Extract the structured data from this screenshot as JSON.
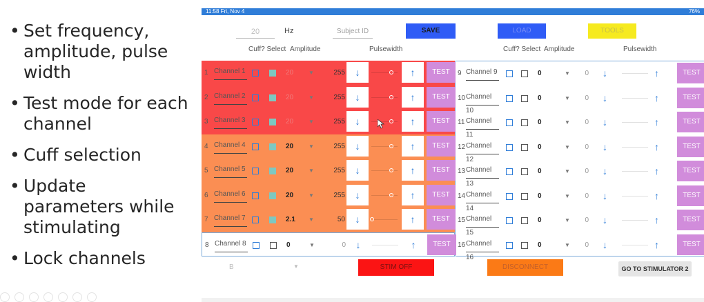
{
  "bullets": [
    "Set frequency, amplitude, pulse width",
    "Test mode for each channel",
    "Cuff selection",
    "Update parameters while stimulating",
    "Lock channels"
  ],
  "status_bar": {
    "left": "11:58  Fri, Nov 4",
    "right": "76%"
  },
  "top": {
    "frequency_value": "20",
    "frequency_unit": "Hz",
    "subject_placeholder": "Subject ID",
    "save_label": "SAVE",
    "load_label": "LOAD",
    "tools_label": "TOOLS"
  },
  "headers": {
    "cuff_select": "Cuff? Select",
    "amplitude": "Amplitude",
    "pulsewidth": "Pulsewidth"
  },
  "left_channels": [
    {
      "num": "1",
      "name": "Channel 1",
      "amp": "20",
      "pw": "255",
      "test": "TEST"
    },
    {
      "num": "2",
      "name": "Channel 2",
      "amp": "20",
      "pw": "255",
      "test": "TEST"
    },
    {
      "num": "3",
      "name": "Channel 3",
      "amp": "20",
      "pw": "255",
      "test": "TEST"
    },
    {
      "num": "4",
      "name": "Channel 4",
      "amp": "20",
      "pw": "255",
      "test": "TEST"
    },
    {
      "num": "5",
      "name": "Channel 5",
      "amp": "20",
      "pw": "255",
      "test": "TEST"
    },
    {
      "num": "6",
      "name": "Channel 6",
      "amp": "20",
      "pw": "255",
      "test": "TEST"
    },
    {
      "num": "7",
      "name": "Channel 7",
      "amp": "2.1",
      "pw": "50",
      "test": "TEST"
    },
    {
      "num": "8",
      "name": "Channel 8",
      "amp": "0",
      "pw": "0",
      "test": "TEST"
    }
  ],
  "right_channels": [
    {
      "num": "9",
      "name": "Channel 9",
      "amp": "0",
      "pw": "0",
      "test": "TEST"
    },
    {
      "num": "10",
      "name": "Channel 10",
      "amp": "0",
      "pw": "0",
      "test": "TEST"
    },
    {
      "num": "11",
      "name": "Channel 11",
      "amp": "0",
      "pw": "0",
      "test": "TEST"
    },
    {
      "num": "12",
      "name": "Channel 12",
      "amp": "0",
      "pw": "0",
      "test": "TEST"
    },
    {
      "num": "13",
      "name": "Channel 13",
      "amp": "0",
      "pw": "0",
      "test": "TEST"
    },
    {
      "num": "14",
      "name": "Channel 14",
      "amp": "0",
      "pw": "0",
      "test": "TEST"
    },
    {
      "num": "15",
      "name": "Channel 15",
      "amp": "0",
      "pw": "0",
      "test": "TEST"
    },
    {
      "num": "16",
      "name": "Channel 16",
      "amp": "0",
      "pw": "0",
      "test": "TEST"
    }
  ],
  "bottom": {
    "b_field": "B",
    "stim_label": "STIM OFF",
    "disconnect_label": "DISCONNECT",
    "go_label": "GO TO STIMULATOR 2"
  },
  "colors": {
    "red_rows": "#f94848",
    "orange_rows": "#fb8e53",
    "test_button": "#d18cdb",
    "blue_accent": "#2f7dd8"
  }
}
